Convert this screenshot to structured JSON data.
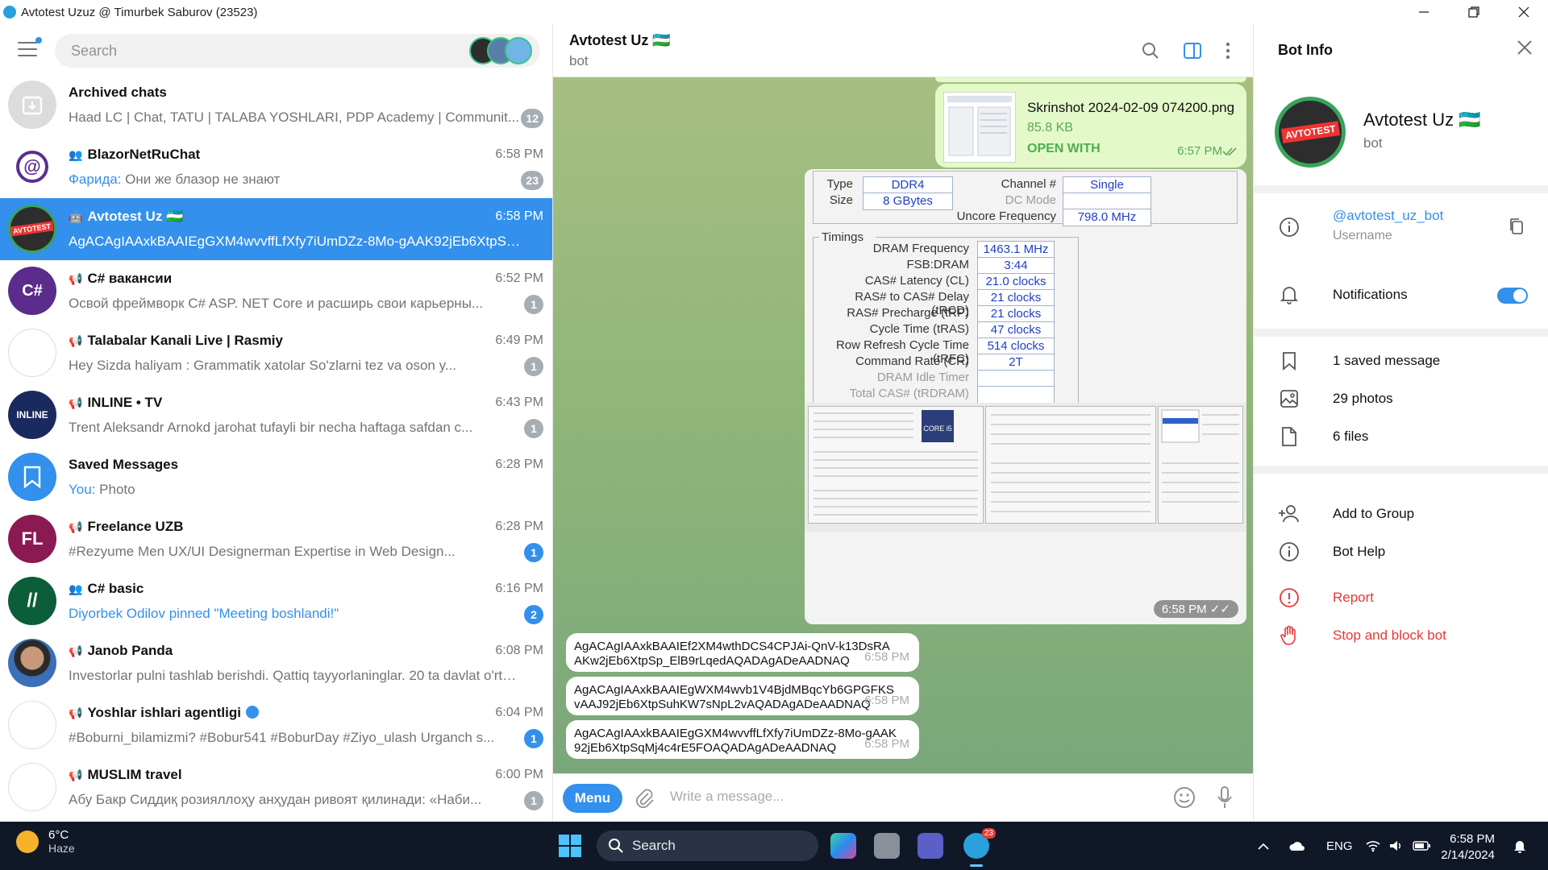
{
  "window": {
    "title": "Avtotest Uzuz @ Timurbek Saburov (23523)"
  },
  "sidebar": {
    "search_placeholder": "Search",
    "chats": [
      {
        "name": "Archived chats",
        "preview": "Haad LC | Chat, TATU | TALABA YOSHLARI, PDP Academy | Communit...",
        "time": "",
        "badge": "12",
        "badge_color": "grey",
        "kind": "",
        "avatar": "archive-icon",
        "avatar_color": "#dcdcdc"
      },
      {
        "name": "BlazorNetRuChat",
        "preview_sender": "Фарида:",
        "preview": " Они же блазор не знают",
        "time": "6:58 PM",
        "badge": "23",
        "badge_color": "grey",
        "kind": "group",
        "avatar": "blazor-logo",
        "avatar_color": "#ffffff"
      },
      {
        "name": "Avtotest Uz",
        "preview": "AgACAgIAAxkBAAIEgGXM4wvvffLfXfy7iUmDZz-8Mo-gAAK92jEb6XtpSqMj4c4rE...",
        "time": "6:58 PM",
        "badge": "",
        "badge_color": "",
        "kind": "bot",
        "avatar": "avtotest-logo",
        "avatar_color": "#2d2d2d",
        "active": true
      },
      {
        "name": "C# вакансии",
        "preview": "Освой фреймворк C# ASP. NET Core и расширь свои карьерны...",
        "time": "6:52 PM",
        "badge": "1",
        "badge_color": "grey",
        "kind": "channel",
        "avatar": "csharp-logo",
        "avatar_color": "#5b2c8b"
      },
      {
        "name": "Talabalar Kanali Live | Rasmiy",
        "preview": "Hey  Sizda haliyam : Grammatik xatolar  So'zlarni tez va oson y...",
        "time": "6:49 PM",
        "badge": "1",
        "badge_color": "grey",
        "kind": "channel",
        "avatar": "talabalar-logo",
        "avatar_color": "#ffffff"
      },
      {
        "name": "INLINE • TV",
        "preview": "Trent Aleksandr Arnokd jarohat tufayli bir necha haftaga safdan c...",
        "time": "6:43 PM",
        "badge": "1",
        "badge_color": "grey",
        "kind": "channel",
        "avatar": "inline-logo",
        "avatar_color": "#1a2a5e"
      },
      {
        "name": "Saved Messages",
        "preview_sender": "You:",
        "preview": "  Photo",
        "time": "6:28 PM",
        "badge": "",
        "badge_color": "",
        "kind": "",
        "avatar": "bookmark-icon",
        "avatar_color": "#3390ec"
      },
      {
        "name": "Freelance UZB",
        "preview": "#Rezyume   Men UX/UI Designerman   Expertise in Web Design...",
        "time": "6:28 PM",
        "badge": "1",
        "badge_color": "blue",
        "kind": "channel",
        "avatar": "FL",
        "avatar_color": "#8b1a52"
      },
      {
        "name": "C# basic",
        "preview": "Diyorbek Odilov pinned \"Meeting boshlandi!\"",
        "preview_highlight": true,
        "time": "6:16 PM",
        "badge": "2",
        "badge_color": "blue",
        "kind": "group",
        "avatar": "codeforge-logo",
        "avatar_color": "#0c5d3a"
      },
      {
        "name": "Janob Panda",
        "preview": "Investorlar pulni tashlab berishdi.  Qattiq tayyorlaninglar. 20 ta davlat o'rtasi...",
        "time": "6:08 PM",
        "badge": "",
        "badge_color": "",
        "kind": "channel",
        "avatar": "person-photo",
        "avatar_color": "#3b6fb6"
      },
      {
        "name": "Yoshlar ishlari agentligi",
        "preview": "#Boburni_bilamizmi? #Bobur541 #BoburDay #Ziyo_ulash  Urganch s...",
        "time": "6:04 PM",
        "badge": "1",
        "badge_color": "blue",
        "kind": "channel",
        "verified": true,
        "avatar": "yoshlar-logo",
        "avatar_color": "#ffffff"
      },
      {
        "name": "MUSLIM travel",
        "preview": "Абу Бакр Сиддиқ розияллоҳу анҳудан ривоят қилинади: «Наби...",
        "time": "6:00 PM",
        "badge": "1",
        "badge_color": "grey",
        "kind": "channel",
        "avatar": "muslim-travel-logo",
        "avatar_color": "#ffffff"
      }
    ]
  },
  "chat": {
    "title": "Avtotest Uz",
    "subtitle": "bot",
    "file": {
      "name": "Skrinshot 2024-02-09 074200.png",
      "size": "85.8 KB",
      "action": "OPEN WITH",
      "time": "6:57 PM"
    },
    "screenshot": {
      "type_label": "Type",
      "type_val": "DDR4",
      "size_label": "Size",
      "size_val": "8 GBytes",
      "channel_label": "Channel #",
      "channel_val": "Single",
      "dc_label": "DC Mode",
      "uncore_label": "Uncore Frequency",
      "uncore_val": "798.0 MHz",
      "timings_label": "Timings",
      "timings": [
        {
          "label": "DRAM Frequency",
          "value": "1463.1 MHz"
        },
        {
          "label": "FSB:DRAM",
          "value": "3:44"
        },
        {
          "label": "CAS# Latency (CL)",
          "value": "21.0 clocks"
        },
        {
          "label": "RAS# to CAS# Delay (tRCD)",
          "value": "21 clocks"
        },
        {
          "label": "RAS# Precharge (tRP)",
          "value": "21 clocks"
        },
        {
          "label": "Cycle Time (tRAS)",
          "value": "47 clocks"
        },
        {
          "label": "Row Refresh Cycle Time (tRFC)",
          "value": "514 clocks"
        },
        {
          "label": "Command Rate (CR)",
          "value": "2T"
        },
        {
          "label": "DRAM Idle Timer",
          "value": ""
        },
        {
          "label": "Total CAS# (tRDRAM)",
          "value": ""
        }
      ],
      "time": "6:58 PM"
    },
    "messages": [
      {
        "text": "AgACAgIAAxkBAAIEf2XM4wthDCS4CPJAi-QnV-k13DsRAAKw2jEb6XtpSp_ElB9rLqedAQADAgADeAADNAQ",
        "time": "6:58 PM"
      },
      {
        "text": "AgACAgIAAxkBAAIEgWXM4wvb1V4BjdMBqcYb6GPGFKSvAAJ92jEb6XtpSuhKW7sNpL2vAQADAgADeAADNAQ",
        "time": "6:58 PM"
      },
      {
        "text": "AgACAgIAAxkBAAIEgGXM4wvvffLfXfy7iUmDZz-8Mo-gAAK92jEb6XtpSqMj4c4rE5FOAQADAgADeAADNAQ",
        "time": "6:58 PM"
      }
    ],
    "composer": {
      "menu_label": "Menu",
      "placeholder": "Write a message..."
    }
  },
  "info": {
    "title": "Bot Info",
    "name": "Avtotest Uz",
    "sub": "bot",
    "username": "@avtotest_uz_bot",
    "username_label": "Username",
    "notifications_label": "Notifications",
    "notifications_on": true,
    "saved": "1 saved message",
    "photos": "29 photos",
    "files": "6 files",
    "add_group": "Add to Group",
    "help": "Bot Help",
    "report": "Report",
    "stop": "Stop and block bot"
  },
  "taskbar": {
    "weather_temp": "6°C",
    "weather_desc": "Haze",
    "search_label": "Search",
    "lang": "ENG",
    "clock_time": "6:58 PM",
    "clock_date": "2/14/2024",
    "telegram_badge": "23"
  },
  "colors": {
    "accent": "#3390ec",
    "out_bubble": "#e3f9c9",
    "chat_bg": "#8fb579"
  }
}
